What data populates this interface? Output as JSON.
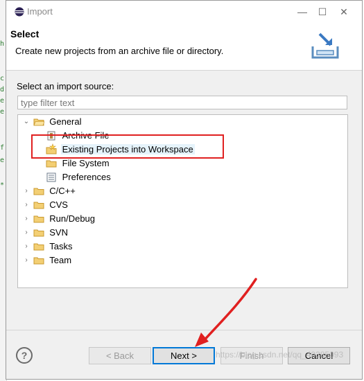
{
  "window": {
    "title": "Import",
    "min_glyph": "—",
    "max_glyph": "☐",
    "close_glyph": "✕"
  },
  "header": {
    "title": "Select",
    "description": "Create new projects from an archive file or directory."
  },
  "source": {
    "label": "Select an import source:",
    "filter_placeholder": "type filter text",
    "filter_value": ""
  },
  "tree": {
    "chevron_open": "⌄",
    "chevron_closed": "›",
    "items": [
      {
        "label": "General",
        "expanded": true
      },
      {
        "label": "Archive File"
      },
      {
        "label": "Existing Projects into Workspace",
        "selected": true
      },
      {
        "label": "File System"
      },
      {
        "label": "Preferences"
      },
      {
        "label": "C/C++"
      },
      {
        "label": "CVS"
      },
      {
        "label": "Run/Debug"
      },
      {
        "label": "SVN"
      },
      {
        "label": "Tasks"
      },
      {
        "label": "Team"
      }
    ]
  },
  "buttons": {
    "help": "?",
    "back": "< Back",
    "next": "Next >",
    "finish": "Finish",
    "cancel": "Cancel"
  },
  "watermark": "https://blog.csdn.net/qq_40385093",
  "colors": {
    "annotation": "#e02020",
    "accent": "#0078d7",
    "folder": "#e8b84a"
  }
}
